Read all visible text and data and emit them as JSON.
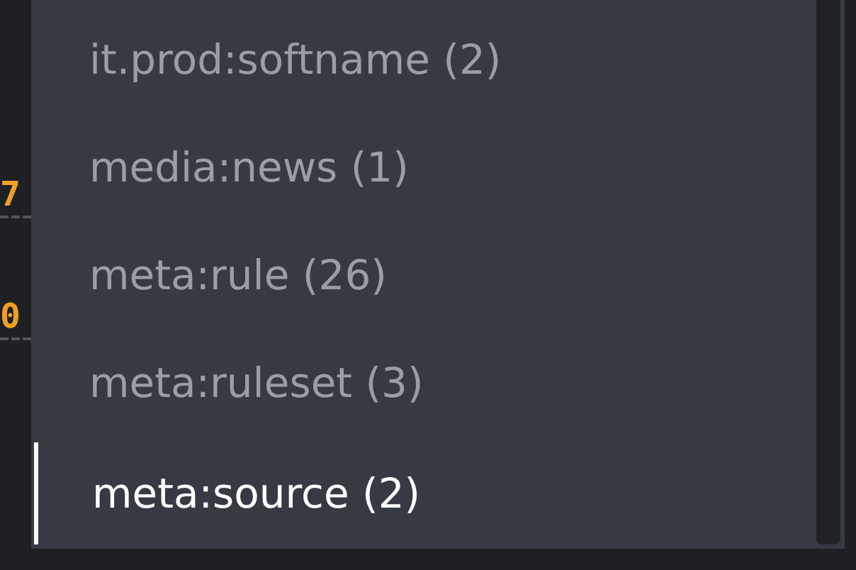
{
  "gutter": [
    {
      "text": "7"
    },
    {
      "text": "0"
    }
  ],
  "menu": {
    "items": [
      {
        "label": "it.prod:softname (2)",
        "selected": false
      },
      {
        "label": "media:news (1)",
        "selected": false
      },
      {
        "label": "meta:rule (26)",
        "selected": false
      },
      {
        "label": "meta:ruleset (3)",
        "selected": false
      },
      {
        "label": "meta:source (2)",
        "selected": true
      }
    ]
  }
}
